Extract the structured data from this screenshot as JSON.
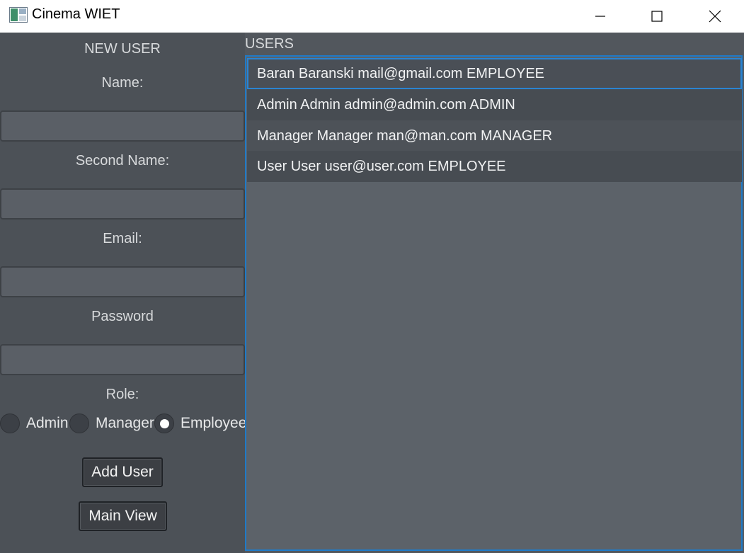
{
  "window": {
    "title": "Cinema WIET"
  },
  "form": {
    "heading": "NEW USER",
    "name_label": "Name:",
    "second_name_label": "Second Name:",
    "email_label": "Email:",
    "password_label": "Password",
    "role_label": "Role:",
    "name_value": "",
    "second_name_value": "",
    "email_value": "",
    "password_value": "",
    "roles": [
      {
        "label": "Admin",
        "checked": false
      },
      {
        "label": "Manager",
        "checked": false
      },
      {
        "label": "Employee",
        "checked": true
      }
    ],
    "add_user_label": "Add User",
    "main_view_label": "Main View"
  },
  "users": {
    "heading": "USERS",
    "items": [
      {
        "text": "Baran Baranski mail@gmail.com EMPLOYEE",
        "selected": true
      },
      {
        "text": "Admin Admin admin@admin.com ADMIN",
        "selected": false
      },
      {
        "text": "Manager Manager man@man.com MANAGER",
        "selected": false
      },
      {
        "text": "User User user@user.com EMPLOYEE",
        "selected": false
      }
    ]
  },
  "colors": {
    "accent": "#1f7ac7",
    "panel_left": "#4c5157",
    "panel_right": "#52575d"
  }
}
